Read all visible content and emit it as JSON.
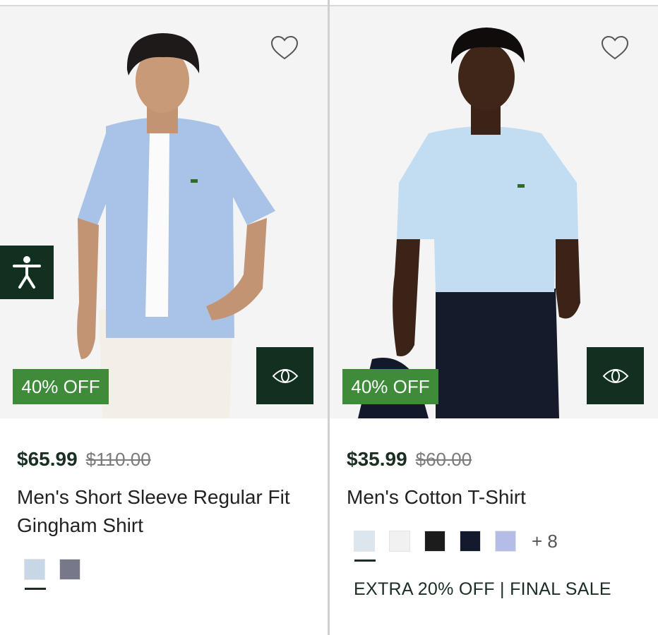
{
  "products": [
    {
      "badge": "40% OFF",
      "sale_price": "$65.99",
      "original_price": "$110.00",
      "name": "Men's Short Sleeve Regular Fit Gingham Shirt",
      "swatches": [
        "#c7d7e6",
        "#77798a"
      ],
      "selected_swatch": 0
    },
    {
      "badge": "40% OFF",
      "sale_price": "$35.99",
      "original_price": "$60.00",
      "name": "Men's Cotton T-Shirt",
      "swatches": [
        "#dbe6ef",
        "#f1f1f1",
        "#1c1c1c",
        "#141a2e",
        "#b3bde6"
      ],
      "selected_swatch": 0,
      "more_colors": "+ 8",
      "promo": "EXTRA 20% OFF | FINAL SALE"
    }
  ],
  "colors": {
    "badge": "#3e8c3a",
    "dark_green": "#12301f",
    "image_bg": "#f4f4f4"
  },
  "icons": {
    "wishlist": "heart-outline-icon",
    "quick_view": "eye-icon",
    "accessibility": "accessibility-person-icon"
  }
}
